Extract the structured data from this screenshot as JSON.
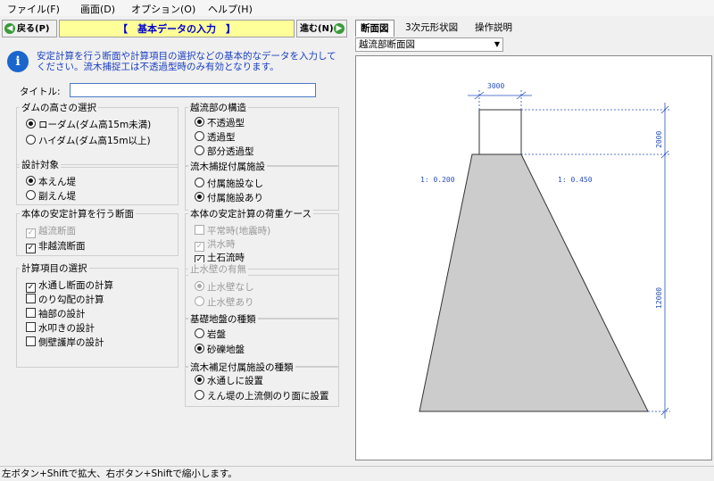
{
  "menu": [
    "ファイル(F)",
    "画面(D)",
    "オプション(O)",
    "ヘルプ(H)"
  ],
  "nav": {
    "back_label": "戻る(P)",
    "next_label": "進む(N)",
    "title": "【　基本データの入力　】"
  },
  "info_text": "安定計算を行う断面や計算項目の選択などの基本的なデータを入力してください。流木捕捉工は不透過型時のみ有効となります。",
  "title_field": {
    "label": "タイトル:",
    "value": ""
  },
  "groups": {
    "dam_height": {
      "title": "ダムの高さの選択",
      "options": [
        "ローダム(ダム高15m未満)",
        "ハイダム(ダム高15m以上)"
      ]
    },
    "target": {
      "title": "設計対象",
      "options": [
        "本えん堤",
        "副えん堤"
      ]
    },
    "section": {
      "title": "本体の安定計算を行う断面",
      "options": [
        "越流断面",
        "非越流断面"
      ]
    },
    "calc_items": {
      "title": "計算項目の選択",
      "options": [
        "水通し断面の計算",
        "のり勾配の計算",
        "袖部の設計",
        "水叩きの設計",
        "側壁護岸の設計"
      ]
    },
    "overflow": {
      "title": "越流部の構造",
      "options": [
        "不透過型",
        "透過型",
        "部分透過型"
      ]
    },
    "debris": {
      "title": "流木捕捉付属施設",
      "options": [
        "付属施設なし",
        "付属施設あり"
      ]
    },
    "load_case": {
      "title": "本体の安定計算の荷重ケース",
      "options": [
        "平常時(地震時)",
        "洪水時",
        "土石流時"
      ]
    },
    "stop_wall": {
      "title": "止水壁の有無",
      "options": [
        "止水壁なし",
        "止水壁あり"
      ]
    },
    "foundation": {
      "title": "基礎地盤の種類",
      "options": [
        "岩盤",
        "砂礫地盤"
      ]
    },
    "debris_aux": {
      "title": "流木補足付属施設の種類",
      "options": [
        "水通しに設置",
        "えん堤の上流側のり面に設置"
      ]
    }
  },
  "tabs": [
    "断面図",
    "3次元形状図",
    "操作説明"
  ],
  "view_select": "越流部断面図",
  "drawing": {
    "top_width": "3000",
    "upper_height": "2000",
    "lower_height": "12000",
    "left_slope": "1: 0.200",
    "right_slope": "1: 0.450"
  },
  "status": "左ボタン+Shiftで拡大、右ボタン+Shiftで縮小します。"
}
